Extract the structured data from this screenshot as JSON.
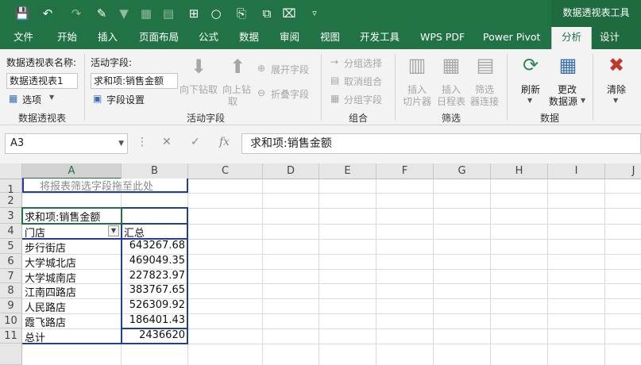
{
  "qat": {
    "icons": [
      "save-icon",
      "undo-icon",
      "redo-icon",
      "eraser-icon",
      "filter-icon",
      "pivot-icon",
      "table-icon",
      "format-icon",
      "circle-icon",
      "text-icon",
      "copy-icon",
      "clear-icon",
      "more-icon"
    ]
  },
  "context_title": "数据透视表工具",
  "tabs": [
    "文件",
    "开始",
    "插入",
    "页面布局",
    "公式",
    "数据",
    "审阅",
    "视图",
    "开发工具",
    "WPS PDF",
    "Power Pivot",
    "分析",
    "设计"
  ],
  "active_tab": "分析",
  "ribbon": {
    "pivot_group": {
      "name_label": "数据透视表名称:",
      "name_value": "数据透视表1",
      "options_label": "选项",
      "group_label": "数据透视表"
    },
    "active_field_group": {
      "label": "活动字段:",
      "value": "求和项:销售金额",
      "field_settings": "字段设置",
      "drill_down": "向下钻取",
      "drill_up_1": "向上钻",
      "drill_up_2": "取",
      "expand": "展开字段",
      "collapse": "折叠字段",
      "group_label": "活动字段"
    },
    "group_group": {
      "group_selection": "分组选择",
      "ungroup": "取消组合",
      "group_field": "分组字段",
      "group_label": "组合"
    },
    "filter_group": {
      "slicer_1": "插入",
      "slicer_2": "切片器",
      "timeline_1": "插入",
      "timeline_2": "日程表",
      "filter_conn_1": "筛选",
      "filter_conn_2": "器连接",
      "group_label": "筛选"
    },
    "data_group": {
      "refresh": "刷新",
      "change_source_1": "更改",
      "change_source_2": "数据源",
      "group_label": "数据"
    },
    "actions_group": {
      "clear": "清除"
    }
  },
  "formula_bar": {
    "name_box": "A3",
    "formula": "求和项:销售金额",
    "fx": "fx"
  },
  "grid": {
    "columns": [
      "A",
      "B",
      "C",
      "D",
      "E",
      "F",
      "G",
      "H",
      "I",
      "J"
    ],
    "rows": [
      "1",
      "2",
      "3",
      "4",
      "5",
      "6",
      "7",
      "8",
      "9",
      "10",
      "11"
    ],
    "filter_hint": "将报表筛选字段拖至此处",
    "pivot": {
      "header_value": "求和项:销售金额",
      "row_label": "门店",
      "col_label": "汇总",
      "items": [
        {
          "store": "步行街店",
          "amount": "643267.68"
        },
        {
          "store": "大学城北店",
          "amount": "469049.35"
        },
        {
          "store": "大学城南店",
          "amount": "227823.97"
        },
        {
          "store": "江南四路店",
          "amount": "383767.65"
        },
        {
          "store": "人民路店",
          "amount": "526309.92"
        },
        {
          "store": "霞飞路店",
          "amount": "186401.43"
        }
      ],
      "total_label": "总计",
      "total_value": "2436620"
    }
  }
}
